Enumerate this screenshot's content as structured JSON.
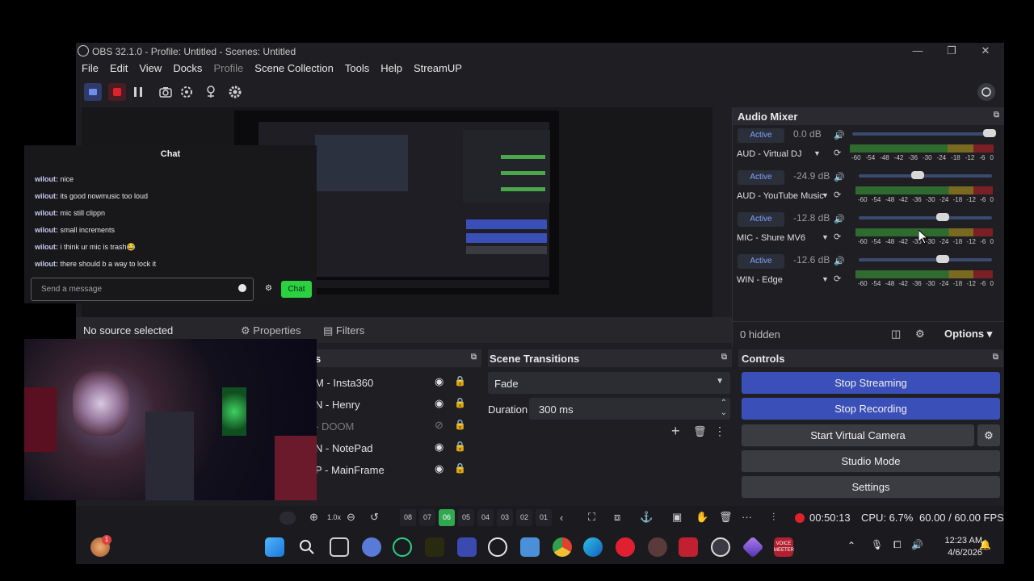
{
  "window": {
    "title": "OBS 32.1.0 - Profile: Untitled - Scenes: Untitled",
    "controls": {
      "minimize": "—",
      "maximize": "❐",
      "close": "✕"
    }
  },
  "menu": [
    "File",
    "Edit",
    "View",
    "Docks",
    "Profile",
    "Scene Collection",
    "Tools",
    "Help",
    "StreamUP"
  ],
  "source_bar": {
    "no_source": "No source selected",
    "properties": "Properties",
    "filters": "Filters"
  },
  "mixer": {
    "title": "Audio Mixer",
    "channels": [
      {
        "name": "AUD - Virtual DJ",
        "status": "Active",
        "db": "0.0 dB",
        "level": 1.0
      },
      {
        "name": "AUD - YouTube Music",
        "status": "Active",
        "db": "-24.9 dB",
        "level": 0.44
      },
      {
        "name": "MIC - Shure MV6",
        "status": "Active",
        "db": "-12.8 dB",
        "level": 0.63
      },
      {
        "name": "WIN - Edge",
        "status": "Active",
        "db": "-12.6 dB",
        "level": 0.63
      }
    ],
    "ticks": [
      "-60",
      "-54",
      "-48",
      "-42",
      "-36",
      "-30",
      "-24",
      "-18",
      "-12",
      "-6",
      "0"
    ],
    "hidden": "0 hidden",
    "options": "Options"
  },
  "sources": {
    "title_suffix": "s",
    "items": [
      {
        "label": "M - Insta360",
        "visible": true
      },
      {
        "label": "N - Henry",
        "visible": true
      },
      {
        "label": "- DOOM",
        "visible": false
      },
      {
        "label": "N - NotePad",
        "visible": true
      },
      {
        "label": "P - MainFrame",
        "visible": true
      }
    ]
  },
  "transitions": {
    "title": "Scene Transitions",
    "selected": "Fade",
    "duration_label": "Duration",
    "duration_value": "300 ms"
  },
  "controls": {
    "title": "Controls",
    "stop_streaming": "Stop Streaming",
    "stop_recording": "Stop Recording",
    "start_virtual_camera": "Start Virtual Camera",
    "studio_mode": "Studio Mode",
    "settings": "Settings"
  },
  "status": {
    "rec_time": "00:50:13",
    "cpu": "CPU: 6.7%",
    "fps": "60.00 / 60.00 FPS",
    "zoom": "1.0x",
    "pages": [
      "08",
      "07",
      "06",
      "05",
      "04",
      "03",
      "02",
      "01"
    ],
    "active_page": "06"
  },
  "chat": {
    "title": "Chat",
    "messages": [
      {
        "user": "wilout:",
        "text": " nice"
      },
      {
        "user": "wilout:",
        "text": " its good nowmusic too loud"
      },
      {
        "user": "wilout:",
        "text": " mic still clippn"
      },
      {
        "user": "wilout:",
        "text": " small increments"
      },
      {
        "user": "wilout:",
        "text": " i think ur mic is trash😂"
      },
      {
        "user": "wilout:",
        "text": " there should b a way to lock it"
      }
    ],
    "placeholder": "Send a message",
    "send_label": "Chat"
  },
  "taskbar": {
    "time": "12:23 AM",
    "date": "4/6/2026",
    "badge": "1",
    "voicemeeter": "VOICE MEETER"
  },
  "colors": {
    "accent": "#3b4fb8",
    "chat_green": "#2bd140",
    "page_active": "#2fa84f",
    "rec_red": "#e0212a"
  }
}
